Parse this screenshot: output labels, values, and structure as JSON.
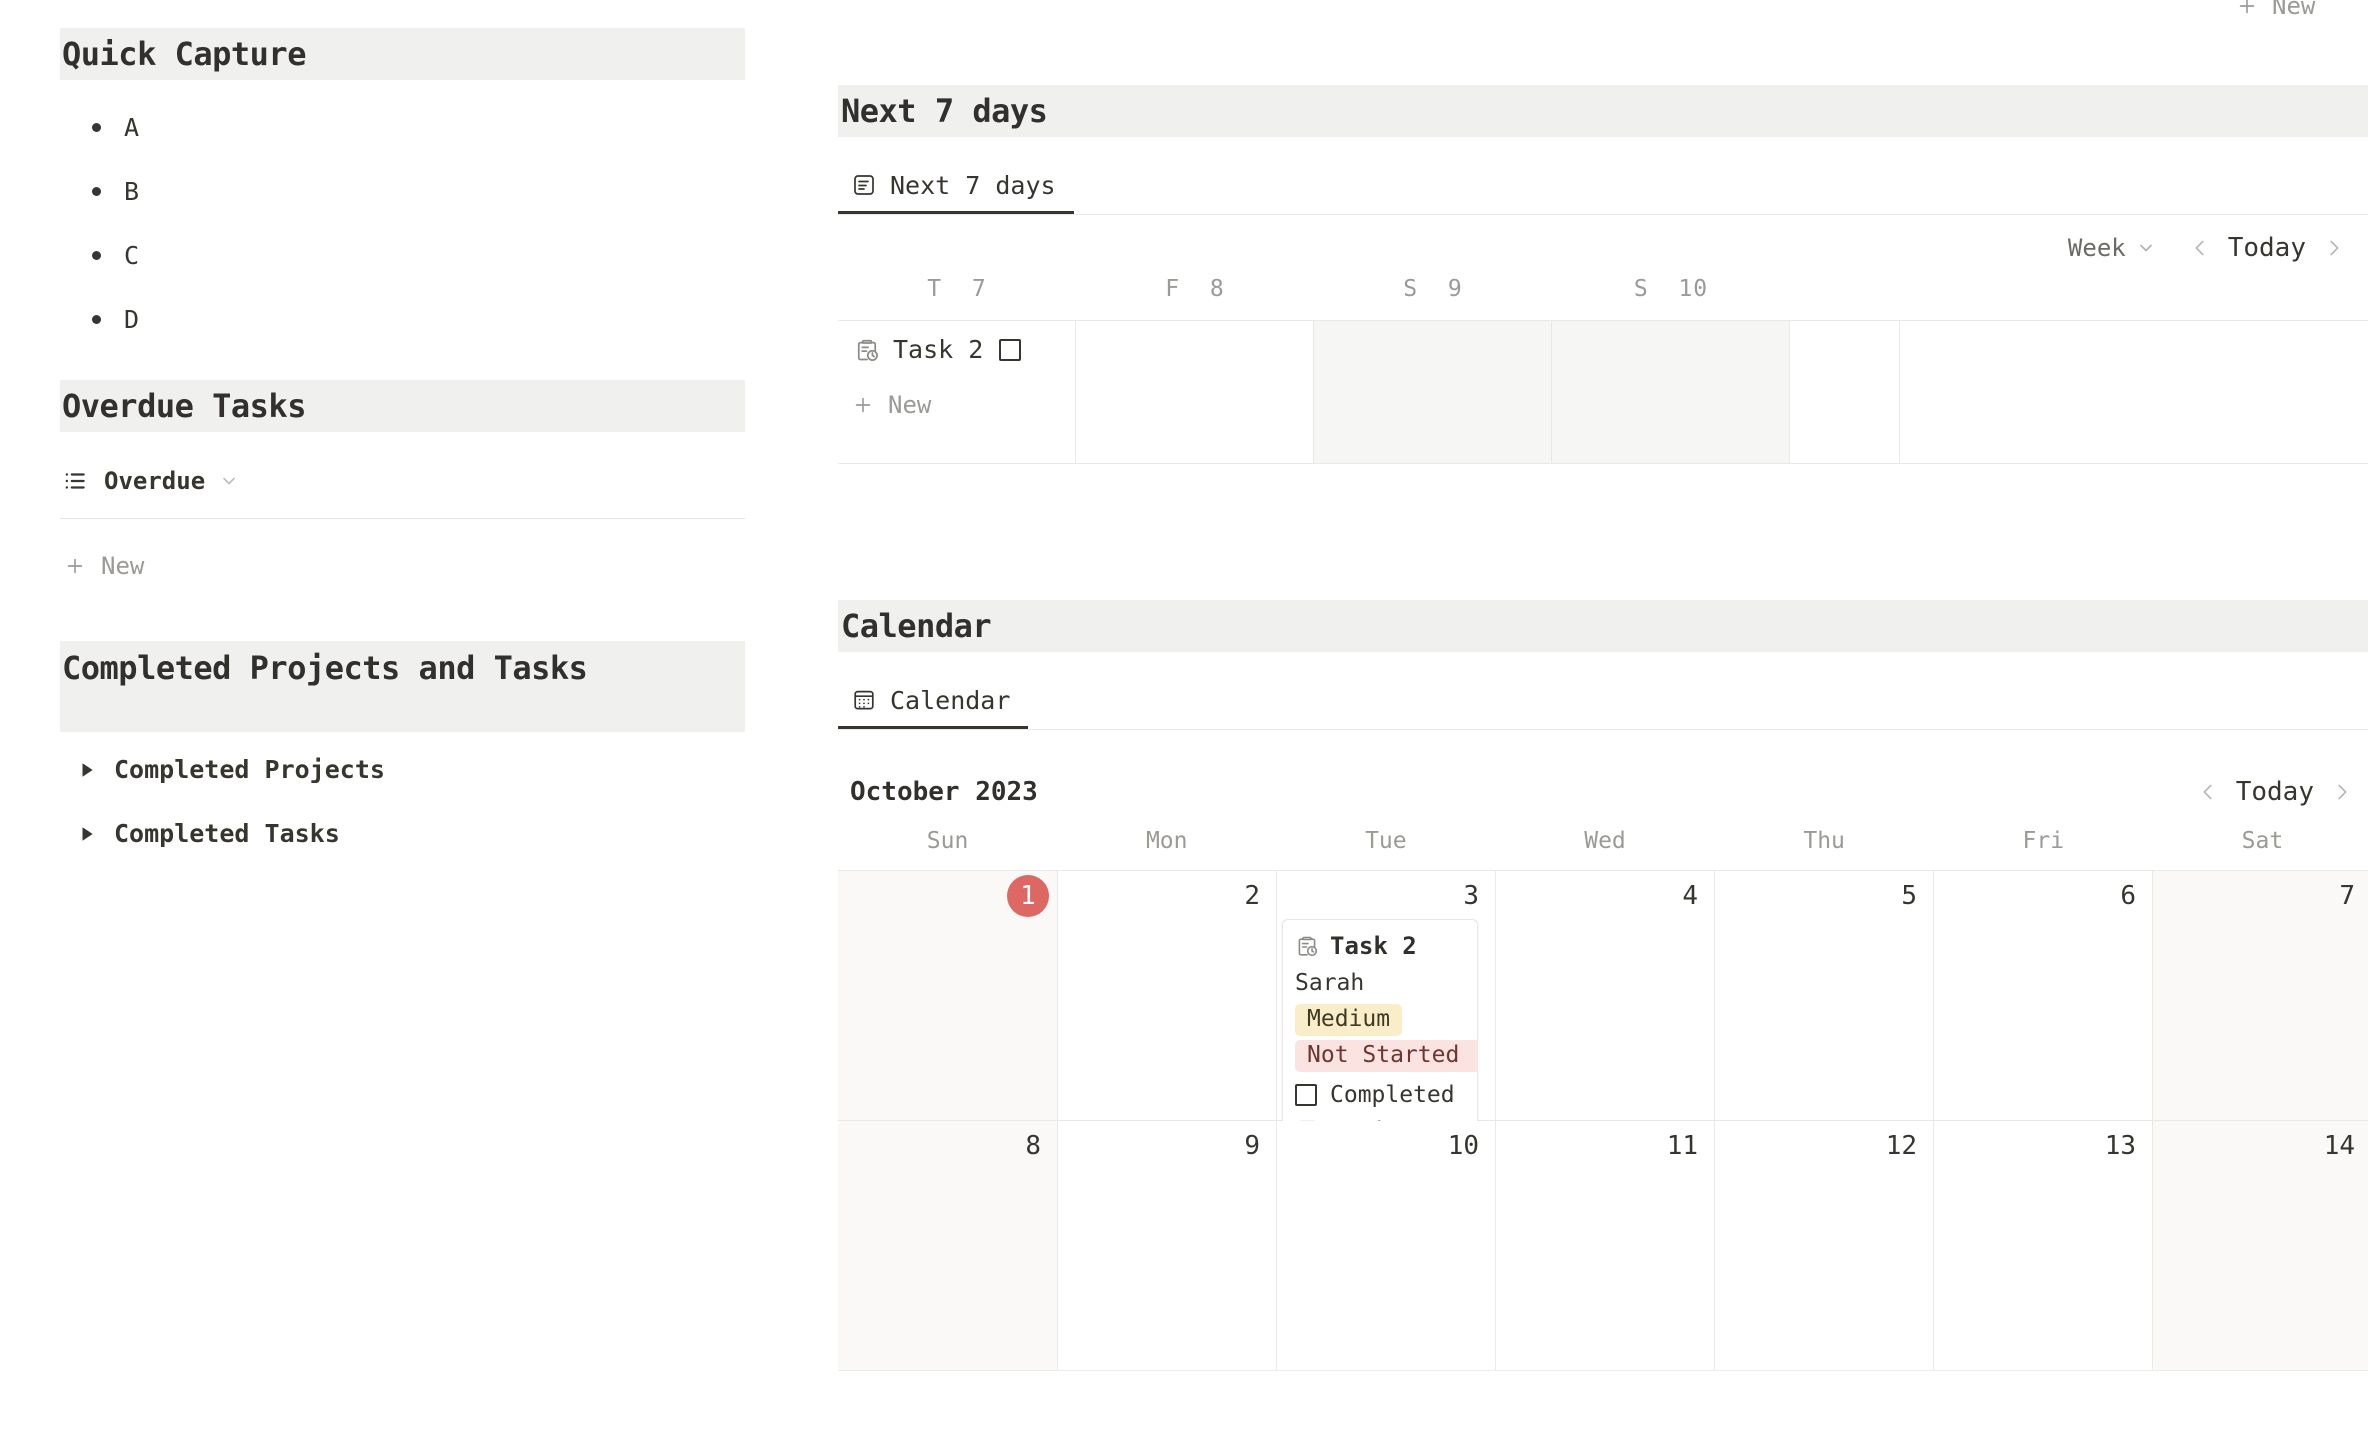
{
  "left": {
    "quick_capture": {
      "title": "Quick Capture",
      "items": [
        "A",
        "B",
        "C",
        "D"
      ]
    },
    "overdue": {
      "title": "Overdue Tasks",
      "view_label": "Overdue",
      "new_label": "New"
    },
    "completed": {
      "title": "Completed Projects and Tasks",
      "toggles": [
        "Completed Projects",
        "Completed Tasks"
      ]
    }
  },
  "right": {
    "top_new_label": "New",
    "next7": {
      "title": "Next 7 days",
      "tab_label": "Next 7 days",
      "toolbar": {
        "view_mode": "Week",
        "today_label": "Today"
      },
      "columns": [
        {
          "dow": "T",
          "day": "7",
          "weekend": false
        },
        {
          "dow": "F",
          "day": "8",
          "weekend": false
        },
        {
          "dow": "S",
          "day": "9",
          "weekend": true
        },
        {
          "dow": "S",
          "day": "10",
          "weekend": true
        }
      ],
      "task": {
        "title": "Task 2",
        "icon": "clipboard-clock-icon"
      },
      "new_label": "New"
    },
    "calendar": {
      "title": "Calendar",
      "tab_label": "Calendar",
      "month_label": "October 2023",
      "today_label": "Today",
      "daynames": [
        "Sun",
        "Mon",
        "Tue",
        "Wed",
        "Thu",
        "Fri",
        "Sat"
      ],
      "weeks": [
        {
          "days": [
            {
              "num": "1",
              "today": true,
              "weekend": true
            },
            {
              "num": "2",
              "today": false,
              "weekend": false
            },
            {
              "num": "3",
              "today": false,
              "weekend": false
            },
            {
              "num": "4",
              "today": false,
              "weekend": false
            },
            {
              "num": "5",
              "today": false,
              "weekend": false
            },
            {
              "num": "6",
              "today": false,
              "weekend": false
            },
            {
              "num": "7",
              "today": false,
              "weekend": true
            }
          ]
        },
        {
          "days": [
            {
              "num": "8",
              "today": false,
              "weekend": true
            },
            {
              "num": "9",
              "today": false,
              "weekend": false
            },
            {
              "num": "10",
              "today": false,
              "weekend": false
            },
            {
              "num": "11",
              "today": false,
              "weekend": false
            },
            {
              "num": "12",
              "today": false,
              "weekend": false
            },
            {
              "num": "13",
              "today": false,
              "weekend": false
            },
            {
              "num": "14",
              "today": false,
              "weekend": true
            }
          ]
        }
      ],
      "event": {
        "title": "Task 2",
        "person": "Sarah",
        "priority": "Medium",
        "status": "Not Started",
        "checkbox_label": "Completed",
        "relation": "Project A"
      }
    }
  },
  "colors": {
    "today_badge": "#d9534f",
    "priority_medium_bg": "#faeeca",
    "status_notstarted_bg": "#fae3e0",
    "section_header_bg": "#f0f0ee"
  }
}
